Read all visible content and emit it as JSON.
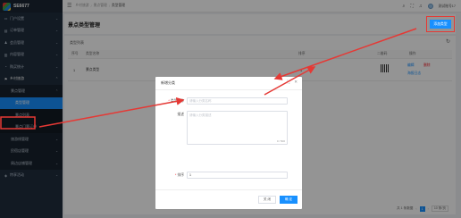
{
  "app": {
    "logo_text": "SE6677"
  },
  "sidebar": {
    "items": [
      {
        "label": "门户设置",
        "icon": "▭"
      },
      {
        "label": "订单管理",
        "icon": "▤"
      },
      {
        "label": "会员管理",
        "icon": "♟"
      },
      {
        "label": "内容管理",
        "icon": "▥"
      },
      {
        "label": "购买统计",
        "icon": "◔"
      },
      {
        "label": "乡村旅游",
        "icon": "⚑"
      }
    ],
    "submenu": {
      "label": "景点管理"
    },
    "subsub": [
      {
        "label": "类型管理",
        "active": true
      },
      {
        "label": "景点列表",
        "active": false
      },
      {
        "label": "景点门票订单",
        "active": false
      }
    ],
    "more_sub": [
      {
        "label": "旅游线管理"
      },
      {
        "label": "民宿店管理"
      },
      {
        "label": "周边店铺管理"
      }
    ],
    "bottom_item": {
      "label": "特享活动",
      "icon": "◈"
    }
  },
  "topbar": {
    "breadcrumb": [
      "乡村旅游",
      "景点管理",
      "类型管理"
    ],
    "username": "测试账号17"
  },
  "page": {
    "title": "景点类型管理",
    "add_button": "添加类型"
  },
  "table": {
    "panel_title": "类型列表",
    "headers": {
      "index": "序号",
      "name": "类型名称",
      "sort": "排序",
      "qrcode": "二维码",
      "actions": "操作"
    },
    "rows": [
      {
        "index": "1",
        "name": "景点类型",
        "sort": "1",
        "actions": {
          "edit": "编辑",
          "delete": "删除",
          "qr_log": "海报日志"
        }
      }
    ]
  },
  "pager": {
    "total": "共 1 条数据",
    "current_page": "1",
    "page_size": "10 条/页"
  },
  "modal": {
    "title": "新增分类",
    "fields": {
      "name_label": "类型名称",
      "name_placeholder": "请输入分类名称",
      "desc_label": "描述",
      "desc_placeholder": "请输入分类描述",
      "desc_counter": "0 / 500",
      "sort_label": "排序",
      "sort_value": "1"
    },
    "close_button": "关 闭",
    "ok_button": "确 定"
  }
}
